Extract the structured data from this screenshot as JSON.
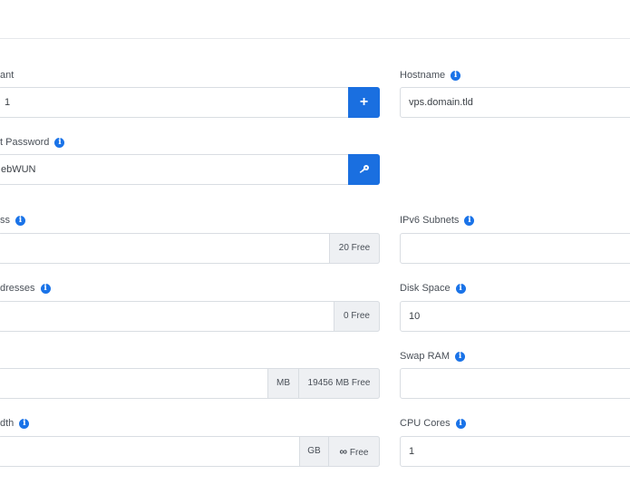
{
  "form": {
    "server": {
      "count_label": "ant",
      "count_value": "1",
      "password_label": "t Password",
      "password_value": "ebWUN",
      "ip_label": "ss",
      "ip_free": "20 Free",
      "ip_addresses_label": "dresses",
      "ip_addresses_free": "0 Free",
      "ram_unit": "MB",
      "ram_free": "19456 MB Free",
      "bandwidth_label": "dth",
      "bandwidth_unit": "GB",
      "bandwidth_free_symbol": "∞",
      "bandwidth_free_text": "Free"
    },
    "right": {
      "hostname_label": "Hostname",
      "hostname_value": "vps.domain.tld",
      "ipv6_label": "IPv6 Subnets",
      "ipv6_value": "",
      "disk_label": "Disk Space",
      "disk_value": "10",
      "swap_label": "Swap RAM",
      "swap_value": "",
      "cpu_label": "CPU Cores",
      "cpu_value": "1"
    }
  },
  "icons": {
    "info": "info-icon",
    "add": "plus-icon",
    "key": "key-icon"
  },
  "colors": {
    "accent": "#1a6fe0",
    "info": "#1a73e8",
    "addon_bg": "#eef0f3",
    "border": "#d9dde2"
  }
}
